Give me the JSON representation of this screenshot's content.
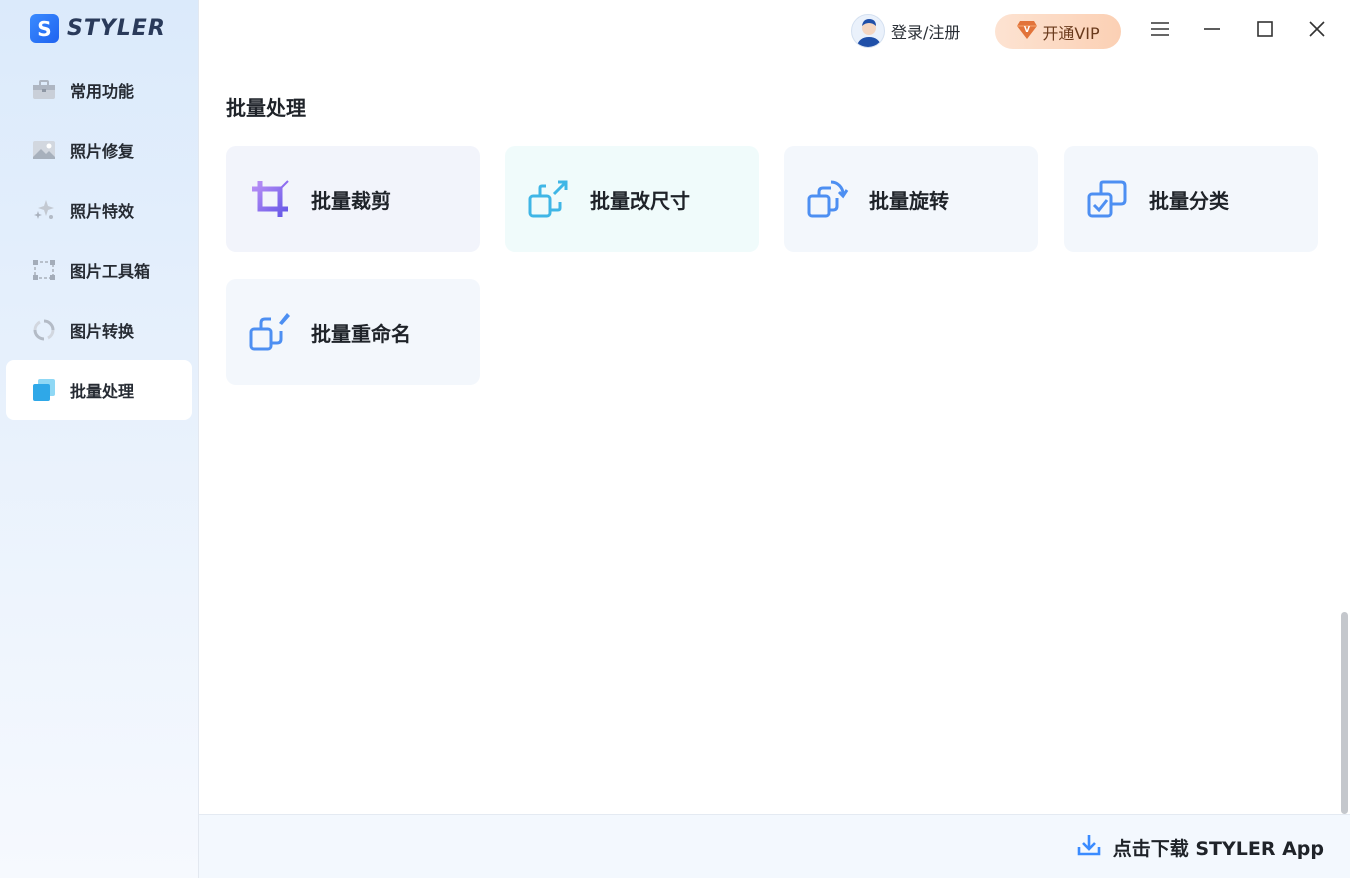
{
  "app": {
    "logo_letter": "S",
    "logo_name": "STYLER"
  },
  "sidebar": {
    "items": [
      {
        "label": "常用功能",
        "icon": "toolbox-icon"
      },
      {
        "label": "照片修复",
        "icon": "photo-icon"
      },
      {
        "label": "照片特效",
        "icon": "sparkle-icon"
      },
      {
        "label": "图片工具箱",
        "icon": "crop-frame-icon"
      },
      {
        "label": "图片转换",
        "icon": "refresh-icon"
      },
      {
        "label": "批量处理",
        "icon": "batch-stack-icon",
        "active": true
      }
    ]
  },
  "topbar": {
    "login_label": "登录/注册",
    "vip_label": "开通VIP"
  },
  "main": {
    "section_title": "批量处理",
    "cards": [
      {
        "label": "批量裁剪",
        "icon": "crop-icon"
      },
      {
        "label": "批量改尺寸",
        "icon": "resize-icon"
      },
      {
        "label": "批量旋转",
        "icon": "rotate-icon"
      },
      {
        "label": "批量分类",
        "icon": "classify-icon"
      },
      {
        "label": "批量重命名",
        "icon": "rename-icon"
      }
    ]
  },
  "footer": {
    "download_label": "点击下载 STYLER App"
  },
  "colors": {
    "accent": "#3a8bff",
    "vip_bg": "#fcd9c3",
    "card_crop_bg": "#f2f4fb",
    "card_resize_bg": "#f0fbfb",
    "card_default_bg": "#f3f7fc"
  }
}
